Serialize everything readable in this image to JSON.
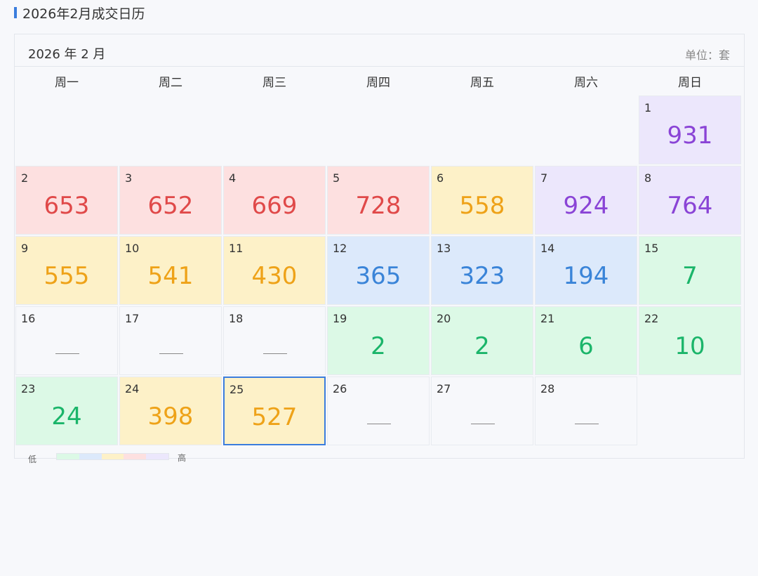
{
  "page": {
    "title": "2026年2月成交日历"
  },
  "calendar": {
    "month_label": "2026 年 2 月",
    "unit_label": "单位：套",
    "weekdays": [
      "周一",
      "周二",
      "周三",
      "周四",
      "周五",
      "周六",
      "周日"
    ],
    "selected_day": 25,
    "days": [
      {
        "day": "1",
        "value": "931",
        "level": "purple"
      },
      {
        "day": "2",
        "value": "653",
        "level": "red"
      },
      {
        "day": "3",
        "value": "652",
        "level": "red"
      },
      {
        "day": "4",
        "value": "669",
        "level": "red"
      },
      {
        "day": "5",
        "value": "728",
        "level": "red"
      },
      {
        "day": "6",
        "value": "558",
        "level": "yellow"
      },
      {
        "day": "7",
        "value": "924",
        "level": "purple"
      },
      {
        "day": "8",
        "value": "764",
        "level": "purple"
      },
      {
        "day": "9",
        "value": "555",
        "level": "yellow"
      },
      {
        "day": "10",
        "value": "541",
        "level": "yellow"
      },
      {
        "day": "11",
        "value": "430",
        "level": "yellow"
      },
      {
        "day": "12",
        "value": "365",
        "level": "blue"
      },
      {
        "day": "13",
        "value": "323",
        "level": "blue"
      },
      {
        "day": "14",
        "value": "194",
        "level": "blue"
      },
      {
        "day": "15",
        "value": "7",
        "level": "green"
      },
      {
        "day": "16",
        "value": null,
        "level": "none"
      },
      {
        "day": "17",
        "value": null,
        "level": "none"
      },
      {
        "day": "18",
        "value": null,
        "level": "none"
      },
      {
        "day": "19",
        "value": "2",
        "level": "green"
      },
      {
        "day": "20",
        "value": "2",
        "level": "green"
      },
      {
        "day": "21",
        "value": "6",
        "level": "green"
      },
      {
        "day": "22",
        "value": "10",
        "level": "green"
      },
      {
        "day": "23",
        "value": "24",
        "level": "green"
      },
      {
        "day": "24",
        "value": "398",
        "level": "yellow"
      },
      {
        "day": "25",
        "value": "527",
        "level": "yellow"
      },
      {
        "day": "26",
        "value": null,
        "level": "none"
      },
      {
        "day": "27",
        "value": null,
        "level": "none"
      },
      {
        "day": "28",
        "value": null,
        "level": "none"
      }
    ],
    "first_weekday_index": 6
  },
  "legend": {
    "low_label": "低",
    "high_label": "高",
    "colors": [
      "#dcf9e6",
      "#dce9fb",
      "#fdf1c8",
      "#fde0e0",
      "#ece7fc"
    ]
  }
}
